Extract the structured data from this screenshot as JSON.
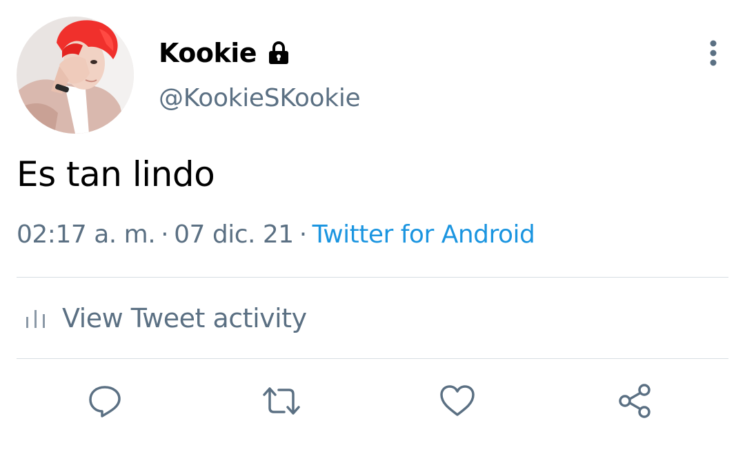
{
  "user": {
    "display_name": "Kookie",
    "handle": "@KookieSKookie",
    "avatar_icon": "avatar-photo",
    "protected_icon": "lock-icon"
  },
  "tweet": {
    "text": "Es tan lindo",
    "time": "02:17 a. m.",
    "separator": "·",
    "date": "07 dic. 21",
    "source": "Twitter for Android"
  },
  "activity": {
    "label": "View Tweet activity",
    "icon": "bar-chart-icon"
  },
  "actions": [
    {
      "name": "reply",
      "icon": "reply-icon"
    },
    {
      "name": "retweet",
      "icon": "retweet-icon"
    },
    {
      "name": "like",
      "icon": "heart-icon"
    },
    {
      "name": "share",
      "icon": "share-icon"
    }
  ],
  "more_icon": "more-vertical-icon",
  "colors": {
    "text_primary": "#000000",
    "text_secondary": "#5b7083",
    "link": "#1b95e0",
    "divider": "#d6dde2",
    "icon": "#5b7083"
  }
}
